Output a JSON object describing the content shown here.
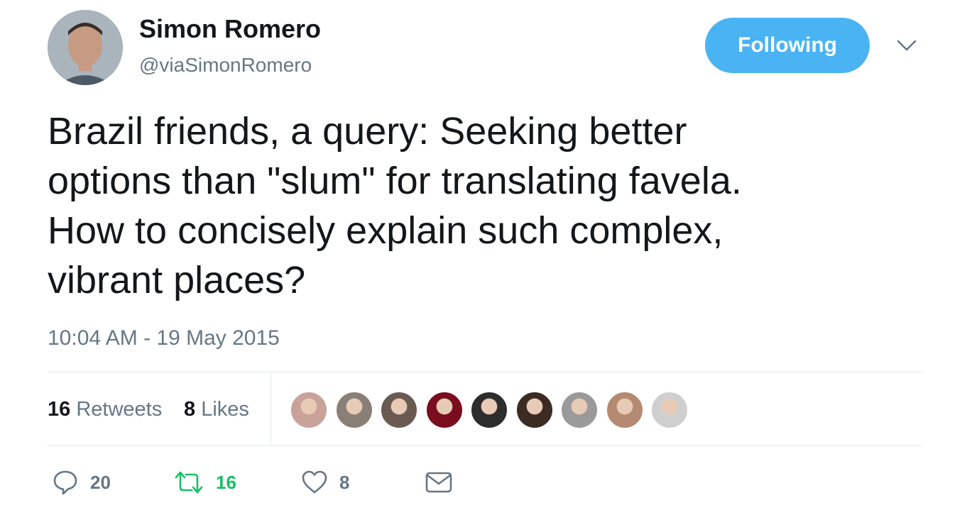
{
  "author": {
    "name": "Simon Romero",
    "handle": "@viaSimonRomero"
  },
  "follow_button": {
    "label": "Following"
  },
  "tweet": {
    "text": "Brazil friends, a query: Seeking better\noptions than \"slum\" for translating favela.\nHow to concisely explain such complex,\nvibrant places?",
    "timestamp": "10:04 AM - 19 May 2015"
  },
  "stats": {
    "retweets_count": "16",
    "retweets_label": "Retweets",
    "likes_count": "8",
    "likes_label": "Likes"
  },
  "likers": [
    {
      "color": "#c9a29a"
    },
    {
      "color": "#8a7f76"
    },
    {
      "color": "#6b5a52"
    },
    {
      "color": "#7a0d1e"
    },
    {
      "color": "#2d2d2d"
    },
    {
      "color": "#3b2b22"
    },
    {
      "color": "#9a9a9a"
    },
    {
      "color": "#b58a72"
    },
    {
      "color": "#cfcfcf"
    }
  ],
  "actions": {
    "reply_count": "20",
    "retweet_count": "16",
    "like_count": "8"
  },
  "colors": {
    "accent": "#4ab3f4",
    "retweet_green": "#17bf63",
    "muted": "#657786",
    "divider": "#e1e8ed"
  },
  "icons": [
    "chevron-down-icon",
    "reply-icon",
    "retweet-icon",
    "heart-icon",
    "envelope-icon"
  ]
}
